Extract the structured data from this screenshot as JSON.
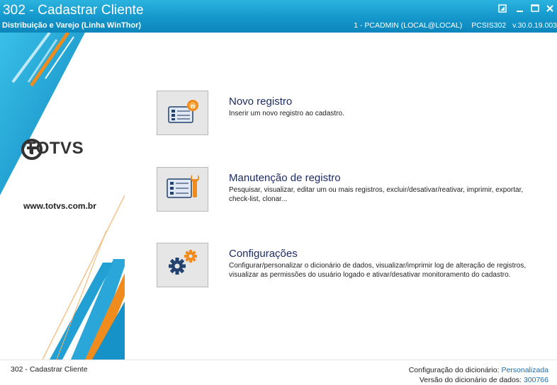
{
  "window": {
    "title": "302 - Cadastrar Cliente",
    "subtitle": "Distribuição e Varejo (Linha WinThor)",
    "user": "1 - PCADMIN (LOCAL@LOCAL)",
    "routine": "PCSIS302",
    "version": "v.30.0.19.003"
  },
  "sidebar": {
    "logo_text": "TOTVS",
    "website": "www.totvs.com.br"
  },
  "options": [
    {
      "title": "Novo registro",
      "description": "Inserir um novo registro ao cadastro.",
      "icon": "new-record-icon"
    },
    {
      "title": "Manutenção de registro",
      "description": "Pesquisar, visualizar, editar um ou mais registros, excluir/desativar/reativar, imprimir, exportar, check-list,  clonar...",
      "icon": "maintenance-icon"
    },
    {
      "title": "Configurações",
      "description": "Configurar/personalizar o dicionário de dados, visualizar/imprimir log de alteração de registros, visualizar as permissões do usuário logado e ativar/desativar monitoramento do cadastro.",
      "icon": "settings-gears-icon"
    }
  ],
  "footer": {
    "left": "302 - Cadastrar Cliente",
    "dict_config_label": "Configuração do dicionário:",
    "dict_config_value": "Personalizada",
    "dict_version_label": "Versão do dicionário de dados:",
    "dict_version_value": "300766"
  },
  "colors": {
    "titlebar": "#1497cb",
    "accent_orange": "#f08c1e",
    "option_title": "#1d2c62",
    "link_value": "#1a6fb0"
  }
}
